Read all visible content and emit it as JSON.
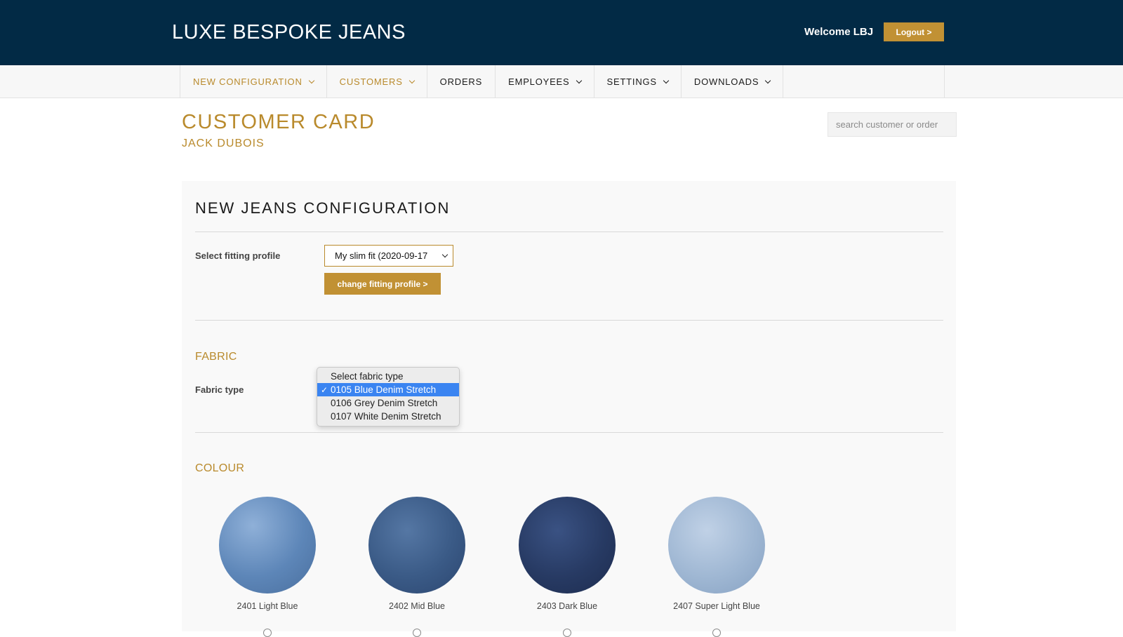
{
  "header": {
    "brand": "LUXE BESPOKE JEANS",
    "welcome": "Welcome LBJ",
    "logout_label": "Logout >"
  },
  "nav": {
    "items": [
      {
        "label": "NEW CONFIGURATION",
        "dropdown": true,
        "active": true
      },
      {
        "label": "CUSTOMERS",
        "dropdown": true,
        "active": true
      },
      {
        "label": "ORDERS",
        "dropdown": false,
        "active": false
      },
      {
        "label": "EMPLOYEES",
        "dropdown": true,
        "active": false
      },
      {
        "label": "SETTINGS",
        "dropdown": true,
        "active": false
      },
      {
        "label": "DOWNLOADS",
        "dropdown": true,
        "active": false
      }
    ]
  },
  "page": {
    "title": "CUSTOMER CARD",
    "customer_name": "JACK DUBOIS",
    "search_placeholder": "search customer or order"
  },
  "config": {
    "title": "NEW JEANS CONFIGURATION",
    "fitting_label": "Select fitting profile",
    "fitting_value": "My slim fit (2020-09-17",
    "change_fitting_label": "change fitting profile >",
    "fabric_heading": "FABRIC",
    "fabric_label": "Fabric type",
    "fabric_options": [
      {
        "label": "Select fabric type",
        "selected": false
      },
      {
        "label": "0105 Blue Denim Stretch",
        "selected": true
      },
      {
        "label": "0106 Grey Denim Stretch",
        "selected": false
      },
      {
        "label": "0107 White Denim Stretch",
        "selected": false
      }
    ],
    "colour_heading": "COLOUR",
    "colours": [
      {
        "label": "2401 Light Blue",
        "color": "#5d86b8"
      },
      {
        "label": "2402 Mid Blue",
        "color": "#3a5a86"
      },
      {
        "label": "2403 Dark Blue",
        "color": "#273a63"
      },
      {
        "label": "2407 Super Light Blue",
        "color": "#9fb7d3"
      }
    ]
  },
  "colors": {
    "header_bg": "#022a45",
    "accent_gold": "#c19134",
    "selected_option": "#3a84f1"
  }
}
